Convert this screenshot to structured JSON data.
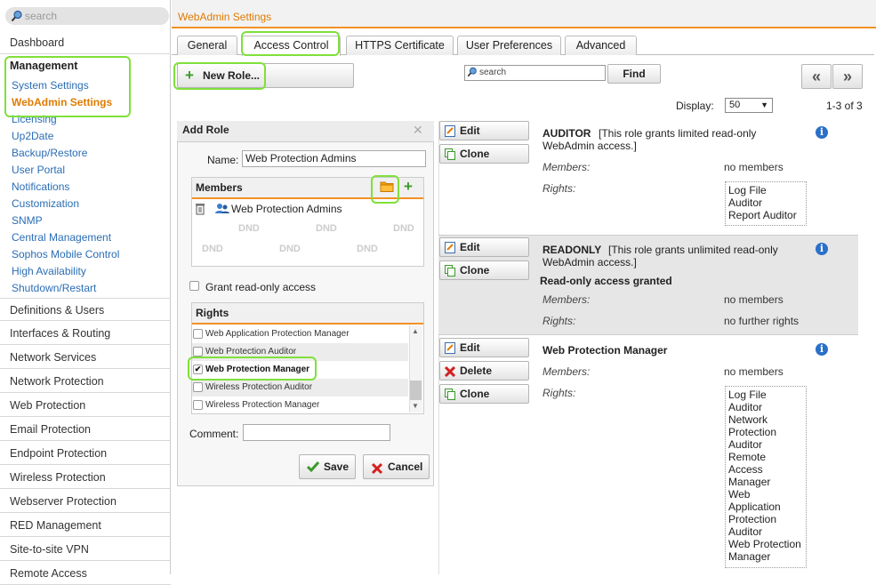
{
  "search": {
    "placeholder": "search"
  },
  "sidebar": {
    "dashboard": "Dashboard",
    "management_title": "Management",
    "management_items": [
      "System Settings",
      "WebAdmin Settings",
      "Licensing",
      "Up2Date",
      "Backup/Restore",
      "User Portal",
      "Notifications",
      "Customization",
      "SNMP",
      "Central Management",
      "Sophos Mobile Control",
      "High Availability",
      "Shutdown/Restart"
    ],
    "sections": [
      "Definitions & Users",
      "Interfaces & Routing",
      "Network Services",
      "Network Protection",
      "Web Protection",
      "Email Protection",
      "Endpoint Protection",
      "Wireless Protection",
      "Webserver Protection",
      "RED Management",
      "Site-to-site VPN",
      "Remote Access"
    ]
  },
  "header": {
    "title": "WebAdmin Settings"
  },
  "tabs": [
    "General",
    "Access Control",
    "HTTPS Certificate",
    "User Preferences",
    "Advanced"
  ],
  "toolbar": {
    "new_role": "New Role...",
    "search_placeholder": "search",
    "find": "Find",
    "prev": "«",
    "next": "»",
    "display_label": "Display:",
    "display_value": "50",
    "count": "1-3 of 3"
  },
  "add_role": {
    "title": "Add Role",
    "name_label": "Name:",
    "name_value": "Web Protection Admins",
    "members_title": "Members",
    "member": "Web Protection Admins",
    "dnd": "DND",
    "grant_label": "Grant read-only access",
    "rights_title": "Rights",
    "rights": [
      {
        "label": "Web Application Protection Manager",
        "checked": false
      },
      {
        "label": "Web Protection Auditor",
        "checked": false
      },
      {
        "label": "Web Protection Manager",
        "checked": true
      },
      {
        "label": "Wireless Protection Auditor",
        "checked": false
      },
      {
        "label": "Wireless Protection Manager",
        "checked": false
      }
    ],
    "comment_label": "Comment:",
    "save": "Save",
    "cancel": "Cancel"
  },
  "actions": {
    "edit": "Edit",
    "clone": "Clone",
    "delete": "Delete"
  },
  "roles": [
    {
      "name": "AUDITOR",
      "desc_1": "[This role grants limited read-only",
      "desc_2": "WebAdmin access.]",
      "members_label": "Members:",
      "members": "no members",
      "rights_label": "Rights:",
      "rights": [
        "Log File",
        "Auditor",
        "Report Auditor"
      ]
    },
    {
      "name": "READONLY",
      "desc_1": "[This role grants unlimited read-only",
      "desc_2": "WebAdmin access.]",
      "note": "Read-only access granted",
      "members_label": "Members:",
      "members": "no members",
      "rights_label": "Rights:",
      "rights_text": "no further rights"
    },
    {
      "name": "Web Protection Manager",
      "members_label": "Members:",
      "members": "no members",
      "rights_label": "Rights:",
      "rights": [
        "Log File",
        "Auditor",
        "Network",
        "Protection",
        "Auditor",
        "Remote",
        "Access",
        "Manager",
        "Web",
        "Application",
        "Protection",
        "Auditor",
        "Web Protection",
        "Manager"
      ]
    }
  ],
  "colors": {
    "accent": "#e07b00",
    "highlight": "#7fe03a",
    "link": "#2a6db5"
  }
}
